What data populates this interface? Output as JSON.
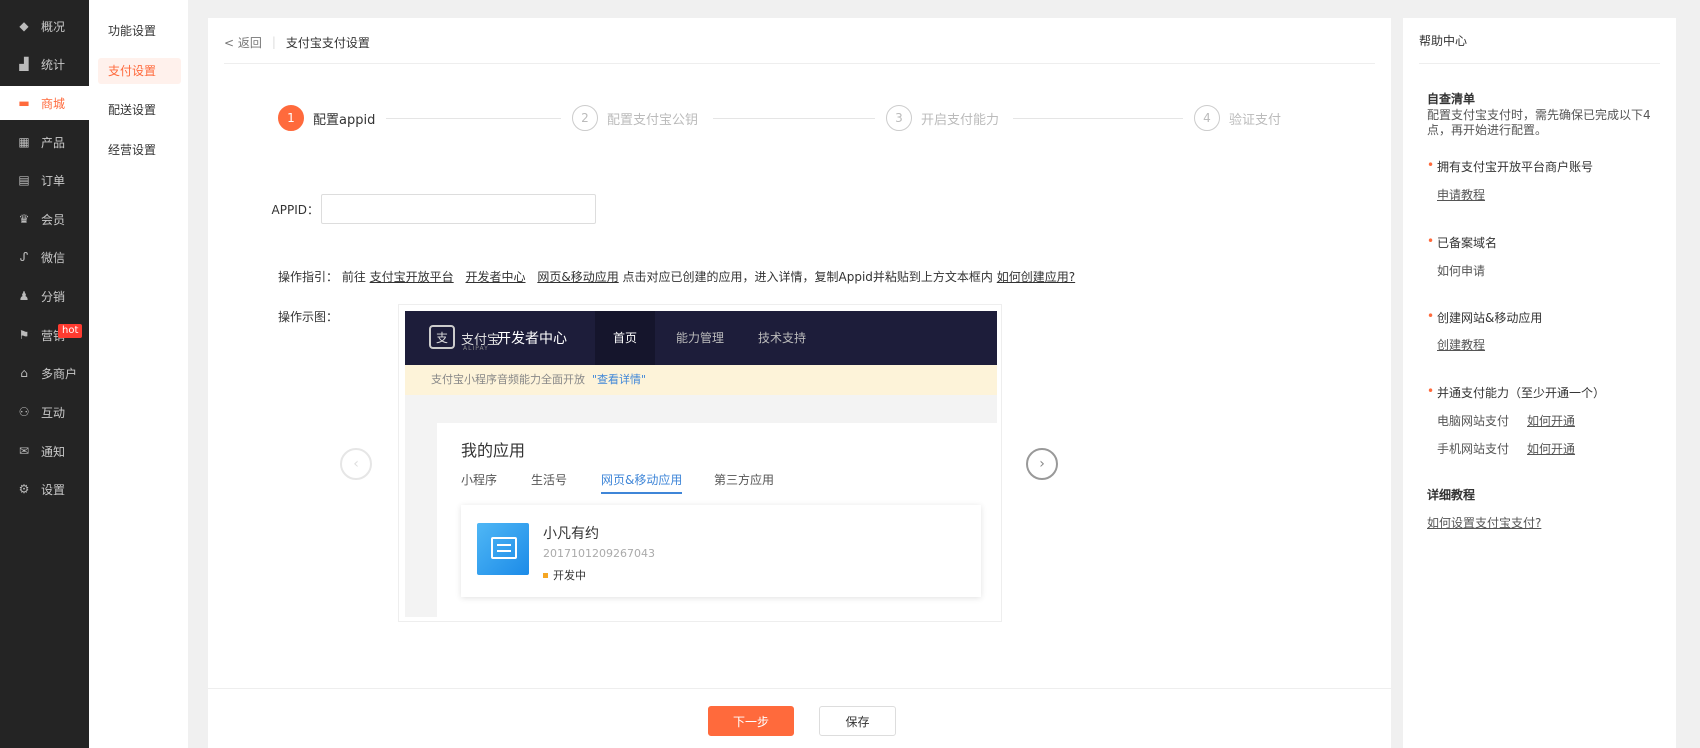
{
  "sidebar": {
    "items": [
      {
        "label": "概况",
        "icon": "layers-icon",
        "glyph": "◆"
      },
      {
        "label": "统计",
        "icon": "chart-icon",
        "glyph": "▟"
      },
      {
        "label": "商城",
        "icon": "store-icon",
        "glyph": "▬"
      },
      {
        "label": "产品",
        "icon": "grid-icon",
        "glyph": "▦"
      },
      {
        "label": "订单",
        "icon": "order-icon",
        "glyph": "▤"
      },
      {
        "label": "会员",
        "icon": "crown-icon",
        "glyph": "♛"
      },
      {
        "label": "微信",
        "icon": "wechat-icon",
        "glyph": "ᔑ"
      },
      {
        "label": "分销",
        "icon": "user-share-icon",
        "glyph": "♟"
      },
      {
        "label": "营销",
        "icon": "flag-icon",
        "glyph": "⚑"
      },
      {
        "label": "多商户",
        "icon": "shop-icon",
        "glyph": "⌂"
      },
      {
        "label": "互动",
        "icon": "users-icon",
        "glyph": "⚇"
      },
      {
        "label": "通知",
        "icon": "mail-icon",
        "glyph": "✉"
      },
      {
        "label": "设置",
        "icon": "gear-icon",
        "glyph": "⚙"
      }
    ],
    "hot_badge": "hot"
  },
  "subnav": {
    "items": [
      "功能设置",
      "支付设置",
      "配送设置",
      "经营设置"
    ]
  },
  "breadcrumb": {
    "back": "< 返回",
    "current": "支付宝支付设置"
  },
  "steps": [
    {
      "num": "1",
      "label": "配置appid"
    },
    {
      "num": "2",
      "label": "配置支付宝公钥"
    },
    {
      "num": "3",
      "label": "开启支付能力"
    },
    {
      "num": "4",
      "label": "验证支付"
    }
  ],
  "appid_field": {
    "label": "APPID：",
    "value": ""
  },
  "guide": {
    "prefix": "操作指引：  前往",
    "link1": "支付宝开放平台",
    "link2": "开发者中心",
    "link3": "网页&移动应用",
    "middle": "点击对应已创建的应用，进入详情，复制Appid并粘贴到上方文本框内",
    "link4": "如何创建应用?"
  },
  "demo_label": "操作示图：",
  "demo": {
    "logo_text": "支付宝",
    "logo_sub": "ALIPAY",
    "dev_center": "开发者中心",
    "nav": [
      "首页",
      "能力管理",
      "技术支持"
    ],
    "notice": "支付宝小程序音频能力全面开放",
    "notice_link": "\"查看详情\"",
    "my_apps": "我的应用",
    "tabs": [
      "小程序",
      "生活号",
      "网页&移动应用",
      "第三方应用"
    ],
    "app_name": "小凡有约",
    "app_id": "2017101209267043",
    "app_status": "开发中"
  },
  "buttons": {
    "next": "下一步",
    "save": "保存"
  },
  "help": {
    "title": "帮助中心",
    "checklist_title": "自查清单",
    "checklist_desc": "配置支付宝支付时，需先确保已完成以下4点，再开始进行配置。",
    "items": [
      {
        "label": "拥有支付宝开放平台商户账号",
        "link": "申请教程"
      },
      {
        "label": "已备案域名",
        "sub": "如何申请"
      },
      {
        "label": "创建网站&移动应用",
        "link": "创建教程"
      },
      {
        "label": "并通支付能力（至少开通一个）"
      }
    ],
    "pc_pay": "电脑网站支付",
    "pc_link": "如何开通",
    "mobile_pay": "手机网站支付",
    "mobile_link": "如何开通",
    "tutorial_title": "详细教程",
    "tutorial_link": "如何设置支付宝支付?"
  }
}
